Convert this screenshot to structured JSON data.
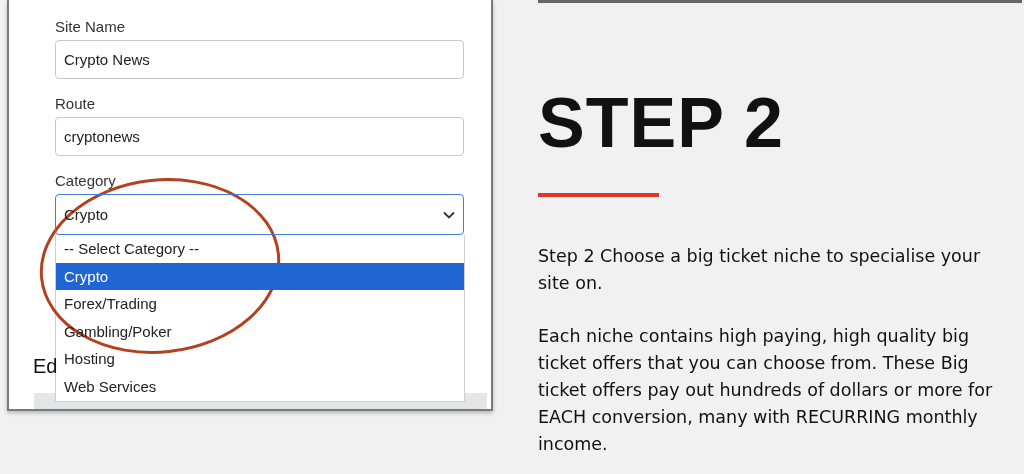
{
  "form": {
    "fields": [
      {
        "label": "Site Name",
        "value": "Crypto News"
      },
      {
        "label": "Route",
        "value": "cryptonews"
      }
    ],
    "category": {
      "label": "Category",
      "value": "Crypto",
      "expanded": true,
      "options": [
        {
          "label": "-- Select Category --",
          "selected": false
        },
        {
          "label": "Crypto",
          "selected": true
        },
        {
          "label": "Forex/Trading",
          "selected": false
        },
        {
          "label": "Gambling/Poker",
          "selected": false
        },
        {
          "label": "Hosting",
          "selected": false
        },
        {
          "label": "Web Services",
          "selected": false
        }
      ]
    },
    "section_heading": "Ed"
  },
  "content": {
    "title": "STEP 2",
    "paragraphs": [
      "Step 2 Choose a big ticket niche to specialise your site on.",
      "Each niche contains high paying, high quality big ticket offers that you can choose from. These Big ticket offers pay out hundreds of dollars or more for EACH conversion, many with RECURRING monthly income."
    ]
  }
}
